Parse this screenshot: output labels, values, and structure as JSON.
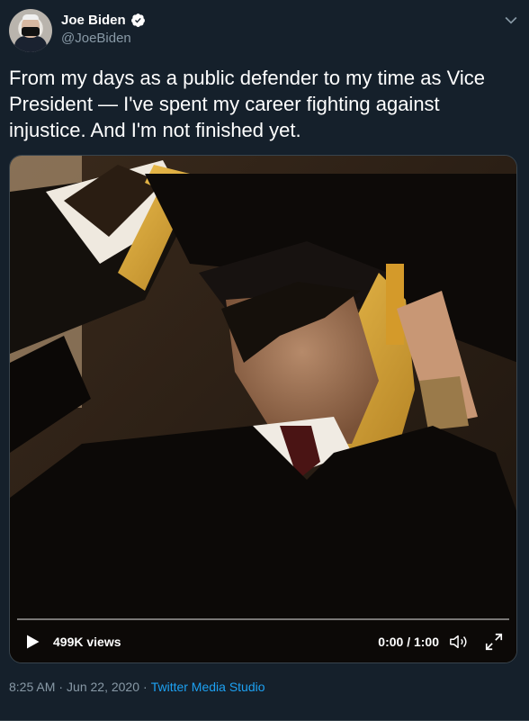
{
  "author": {
    "name": "Joe Biden",
    "handle": "@JoeBiden",
    "verified": true,
    "avatar_icon": "profile-photo-masked"
  },
  "tweet": {
    "text": "From my days as a public defender to my time as Vice President — I've spent my career fighting against injustice. And I'm not finished yet."
  },
  "video": {
    "views": "499K views",
    "timecode": "0:00 / 1:00",
    "progress": 0.0,
    "play_icon": "play-icon",
    "volume_icon": "volume-icon",
    "fullscreen_icon": "fullscreen-icon"
  },
  "meta": {
    "time": "8:25 AM",
    "separator1": "·",
    "date": "Jun 22, 2020",
    "separator2": "·",
    "source": "Twitter Media Studio"
  },
  "colors": {
    "background": "#15202b",
    "secondary_text": "#8899a6",
    "accent": "#1da1f2",
    "border": "#38444d"
  }
}
